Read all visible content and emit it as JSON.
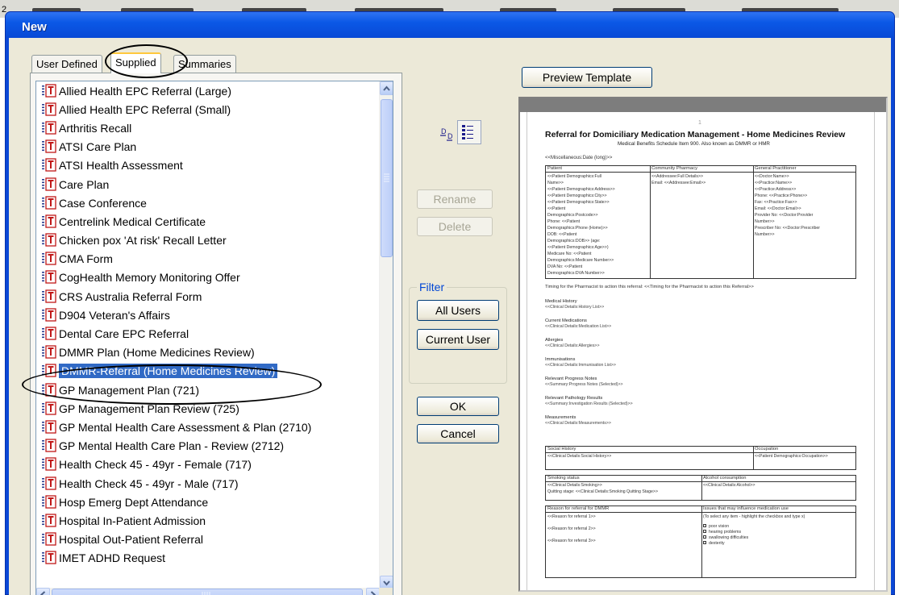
{
  "window": {
    "title": "New"
  },
  "tabs": [
    {
      "label": "User Defined",
      "active": false
    },
    {
      "label": "Supplied",
      "active": true
    },
    {
      "label": "Summaries",
      "active": false
    }
  ],
  "templates": [
    "Allied Health EPC Referral (Large)",
    "Allied Health EPC Referral (Small)",
    "Arthritis Recall",
    "ATSI Care Plan",
    "ATSI Health Assessment",
    "Care Plan",
    "Case Conference",
    "Centrelink Medical Certificate",
    "Chicken pox 'At risk' Recall Letter",
    "CMA Form",
    "CogHealth Memory Monitoring Offer",
    "CRS Australia Referral Form",
    "D904 Veteran's Affairs",
    "Dental Care EPC Referral",
    "DMMR Plan (Home Medicines Review)",
    "DMMR-Referral (Home Medicines Review)",
    "GP Management Plan (721)",
    "GP Management Plan Review (725)",
    "GP Mental Health Care Assessment & Plan (2710)",
    "GP Mental Health Care Plan - Review (2712)",
    "Health Check 45 - 49yr - Female (717)",
    "Health Check 45 - 49yr - Male (717)",
    "Hosp Emerg Dept Attendance",
    "Hospital In-Patient Admission",
    "Hospital Out-Patient Referral",
    "IMET ADHD Request"
  ],
  "selected_index": 15,
  "view_toggle": {
    "large_icon_glyph": "D",
    "list_glyph": "≡"
  },
  "buttons": {
    "rename": "Rename",
    "delete": "Delete",
    "all_users": "All Users",
    "current_user": "Current User",
    "ok": "OK",
    "cancel": "Cancel",
    "preview_template": "Preview Template"
  },
  "filter": {
    "label": "Filter"
  },
  "preview": {
    "page_number": "1",
    "title": "Referral for Domiciliary Medication Management - Home Medicines Review",
    "subtitle": "Medical Benefits Schedule Item 900. Also known as DMMR or HMR",
    "misc": "<<Miscellaneous:Date (long)>>",
    "col_patient": "Patient",
    "col_pharmacy": "Community Pharmacy",
    "col_gp": "General Practitioner",
    "patient_lines": [
      "<<Patient Demographics:Full",
      "Name>>",
      "<<Patient Demographics:Address>>",
      "<<Patient Demographics:City>>",
      "<<Patient Demographics:State>>",
      "<<Patient",
      "Demographics:Postcode>>",
      "Phone: <<Patient",
      "Demographics:Phone (Home)>>",
      "DOB: <<Patient",
      "Demographics:DOB>> (age:",
      "<<Patient Demographics:Age>>)",
      "Medicare No: <<Patient",
      "Demographics:Medicare Number>>",
      "DVA No: <<Patient",
      "Demographics:DVA Number>>"
    ],
    "pharmacy_lines": [
      "<<Addressee:Full Details>>",
      "Email: <<Addressee:Email>>"
    ],
    "gp_lines": [
      "<<Doctor:Name>>",
      "<<Practice:Name>>",
      "<<Practice:Address>>",
      "Phone: <<Practice:Phone>>",
      "Fax: <<Practice:Fax>>",
      "Email: <<Doctor:Email>>",
      "Provider No: <<Doctor:Provider",
      "Number>>",
      "Prescriber No: <<Doctor:Prescriber",
      "Number>>"
    ],
    "timing": "Timing for the Pharmacist to action this referral: <<Timing for the Pharmacist to action this Referral>>",
    "sections": [
      {
        "heading": "Medical History",
        "value": "<<Clinical Details:History List>>"
      },
      {
        "heading": "Current Medications",
        "value": "<<Clinical Details:Medication List>>"
      },
      {
        "heading": "Allergies",
        "value": "<<Clinical Details:Allergies>>"
      },
      {
        "heading": "Immunisations",
        "value": "<<Clinical Details:Immunisation List>>"
      },
      {
        "heading": "Relevant Progress Notes",
        "value": "<<Summary:Progress Notes (Selected)>>"
      },
      {
        "heading": "Relevant Pathology Results",
        "value": "<<Summary:Investigation Results (Selected)>>"
      },
      {
        "heading": "Measurements",
        "value": "<<Clinical Details:Measurements>>"
      }
    ],
    "social_history": "Social History",
    "social_value": "<<Clinical Details:Social History>>",
    "occupation": "Occupation",
    "occupation_value": "<<Patient Demographics:Occupation>>",
    "smoking": "Smoking status",
    "smoking_value": "<<Clinical Details:Smoking>>",
    "quitting": "Quitting stage: <<Clinical Details:Smoking Quitting Stage>>",
    "alcohol": "Alcohol consumption",
    "alcohol_value": "<<Clinical Details:Alcohol>>",
    "reason": "Reason for referral for DMMR",
    "reason_values": [
      "<<Reason for referral 1>>",
      "<<Reason for referral 2>>",
      "<<Reason for referral 3>>"
    ],
    "issues": "Issues that may influence medication use",
    "issues_hint": "(To select any item - highlight the checkbox and type x)",
    "issues_values": [
      "poor vision",
      "hearing problems",
      "swallowing difficulties",
      "dexterity"
    ]
  },
  "background": {
    "number": "2"
  }
}
